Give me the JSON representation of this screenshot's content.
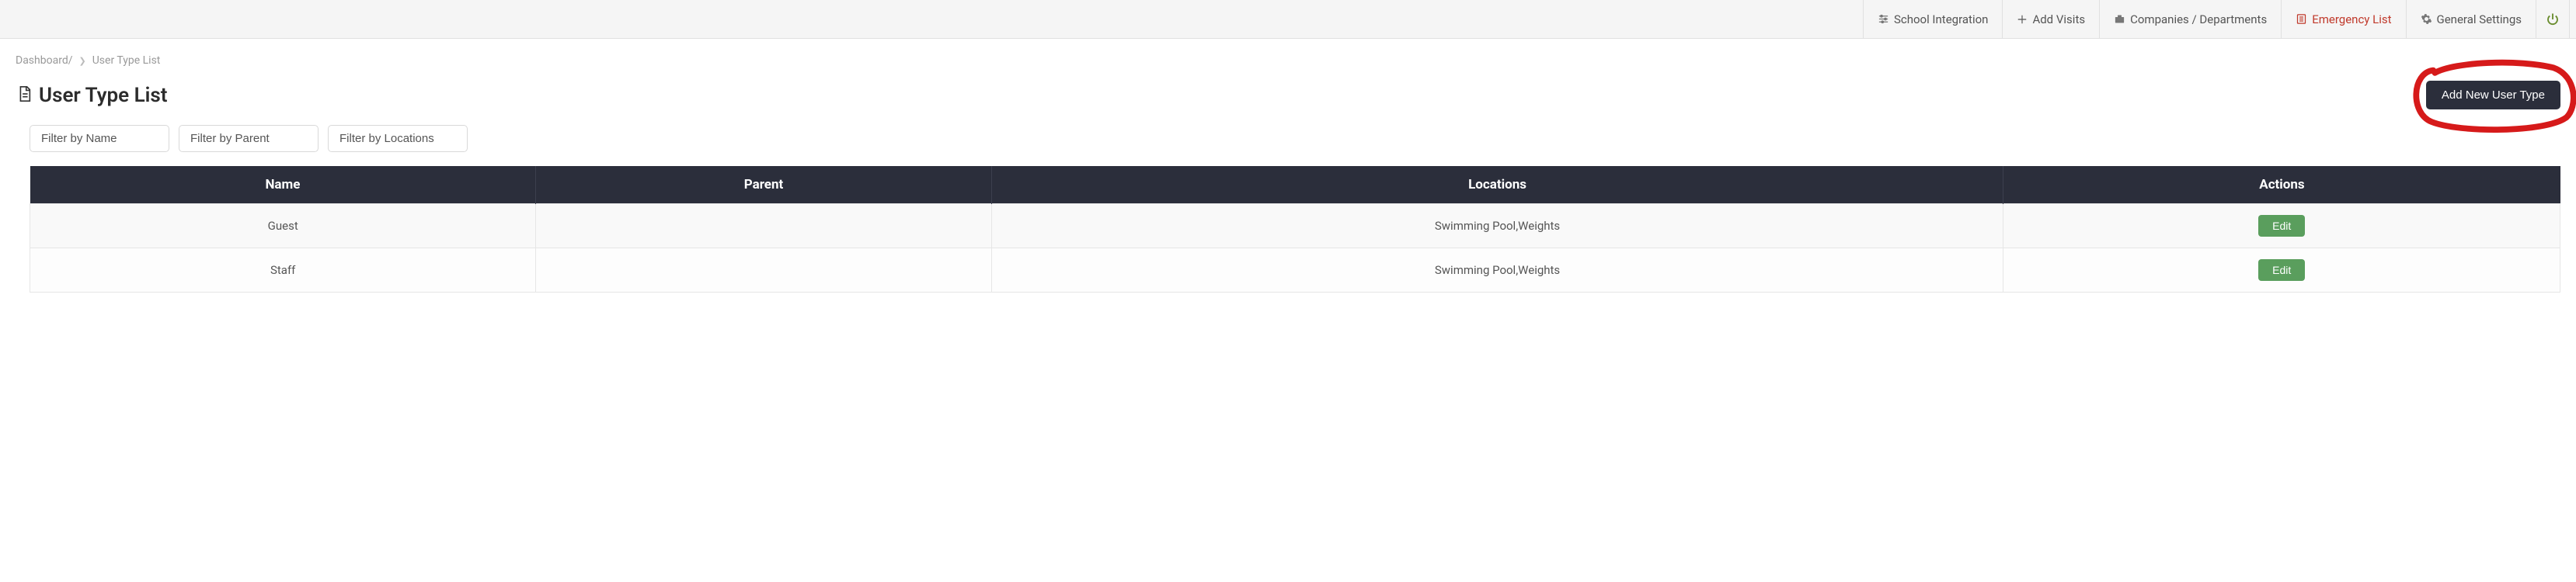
{
  "topnav": {
    "school_integration": "School Integration",
    "add_visits": "Add Visits",
    "companies_departments": "Companies / Departments",
    "emergency_list": "Emergency List",
    "general_settings": "General Settings"
  },
  "breadcrumb": {
    "dashboard": "Dashboard/",
    "current": "User Type List"
  },
  "page": {
    "title": "User Type List",
    "add_button": "Add New User Type"
  },
  "filters": {
    "name": "Filter by Name",
    "parent": "Filter by Parent",
    "locations": "Filter by Locations"
  },
  "table": {
    "headers": {
      "name": "Name",
      "parent": "Parent",
      "locations": "Locations",
      "actions": "Actions"
    },
    "rows": [
      {
        "name": "Guest",
        "parent": "",
        "locations": "Swimming Pool,Weights",
        "edit": "Edit"
      },
      {
        "name": "Staff",
        "parent": "",
        "locations": "Swimming Pool,Weights",
        "edit": "Edit"
      }
    ]
  }
}
